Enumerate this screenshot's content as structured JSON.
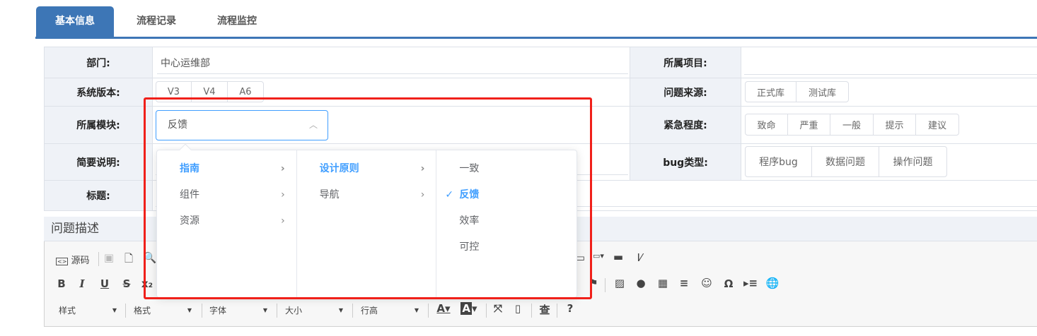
{
  "tabs": [
    {
      "label": "基本信息",
      "active": true
    },
    {
      "label": "流程记录"
    },
    {
      "label": "流程监控"
    }
  ],
  "form": {
    "department_label": "部门:",
    "department_value": "中心运维部",
    "project_label": "所属项目:",
    "project_value": "",
    "version_label": "系统版本:",
    "versions": [
      "V3",
      "V4",
      "A6"
    ],
    "source_label": "问题来源:",
    "sources": [
      "正式库",
      "测试库"
    ],
    "module_label": "所属模块:",
    "module_value": "反馈",
    "urgency_label": "紧急程度:",
    "urgencies": [
      "致命",
      "严重",
      "一般",
      "提示",
      "建议"
    ],
    "summary_label": "简要说明:",
    "bugtype_label": "bug类型:",
    "bugtypes": [
      "程序bug",
      "数据问题",
      "操作问题"
    ],
    "title_label": "标题:"
  },
  "cascader": {
    "col1": [
      {
        "label": "指南",
        "selected": true
      },
      {
        "label": "组件"
      },
      {
        "label": "资源"
      }
    ],
    "col2": [
      {
        "label": "设计原则",
        "selected": true
      },
      {
        "label": "导航"
      }
    ],
    "col3": [
      {
        "label": "一致"
      },
      {
        "label": "反馈",
        "selected": true
      },
      {
        "label": "效率"
      },
      {
        "label": "可控"
      }
    ]
  },
  "description": {
    "title": "问题描述"
  },
  "editor": {
    "source_label": "源码",
    "combos": [
      "样式",
      "格式",
      "字体",
      "大小",
      "行高"
    ],
    "bold": "B",
    "italic": "I",
    "underline": "U",
    "strike": "S",
    "subscript": "x₂",
    "omega": "Ω",
    "about": "查",
    "help": "?"
  },
  "colors": {
    "accent": "#3d76b6",
    "active": "#409eff",
    "highlight": "#f0201a"
  }
}
